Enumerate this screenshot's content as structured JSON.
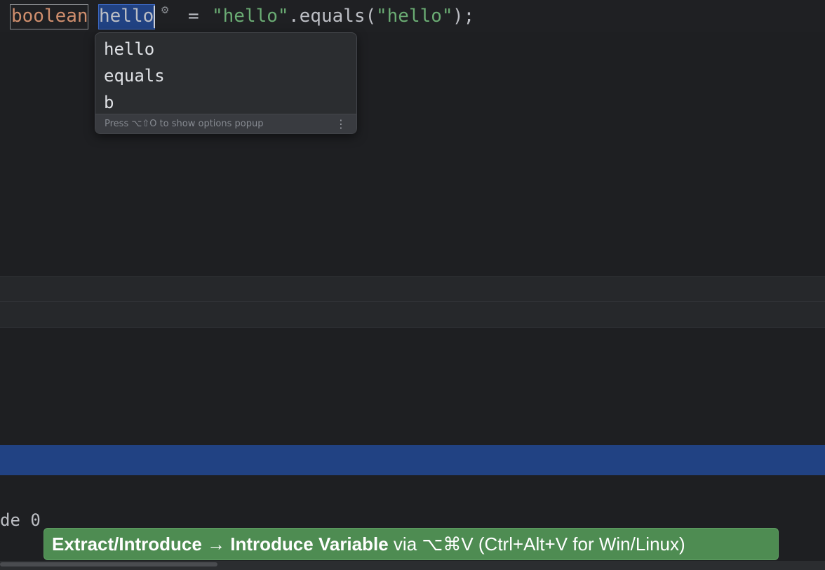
{
  "editor": {
    "code_line": {
      "keyword": "boolean",
      "variable": "hello",
      "equals": "=",
      "string1": "\"hello\"",
      "method_call": ".equals(",
      "string2": "\"hello\"",
      "tail": ");"
    },
    "gear_icon": "gear-icon",
    "partial_line": "de 0"
  },
  "popup": {
    "items": [
      "hello",
      "equals",
      "b"
    ],
    "footer_text": "Press ⌥⇧O to show options popup",
    "more_icon": "more-vertical-icon"
  },
  "hint": {
    "bold_text": "Extract/Introduce → Introduce Variable",
    "normal_text": " via ⌥⌘V (Ctrl+Alt+V for Win/Linux)",
    "background_color": "#4e8c52"
  },
  "colors": {
    "editor_bg": "#1e1f22",
    "keyword": "#cf8e6d",
    "string": "#6aab73",
    "selection": "#214283"
  }
}
